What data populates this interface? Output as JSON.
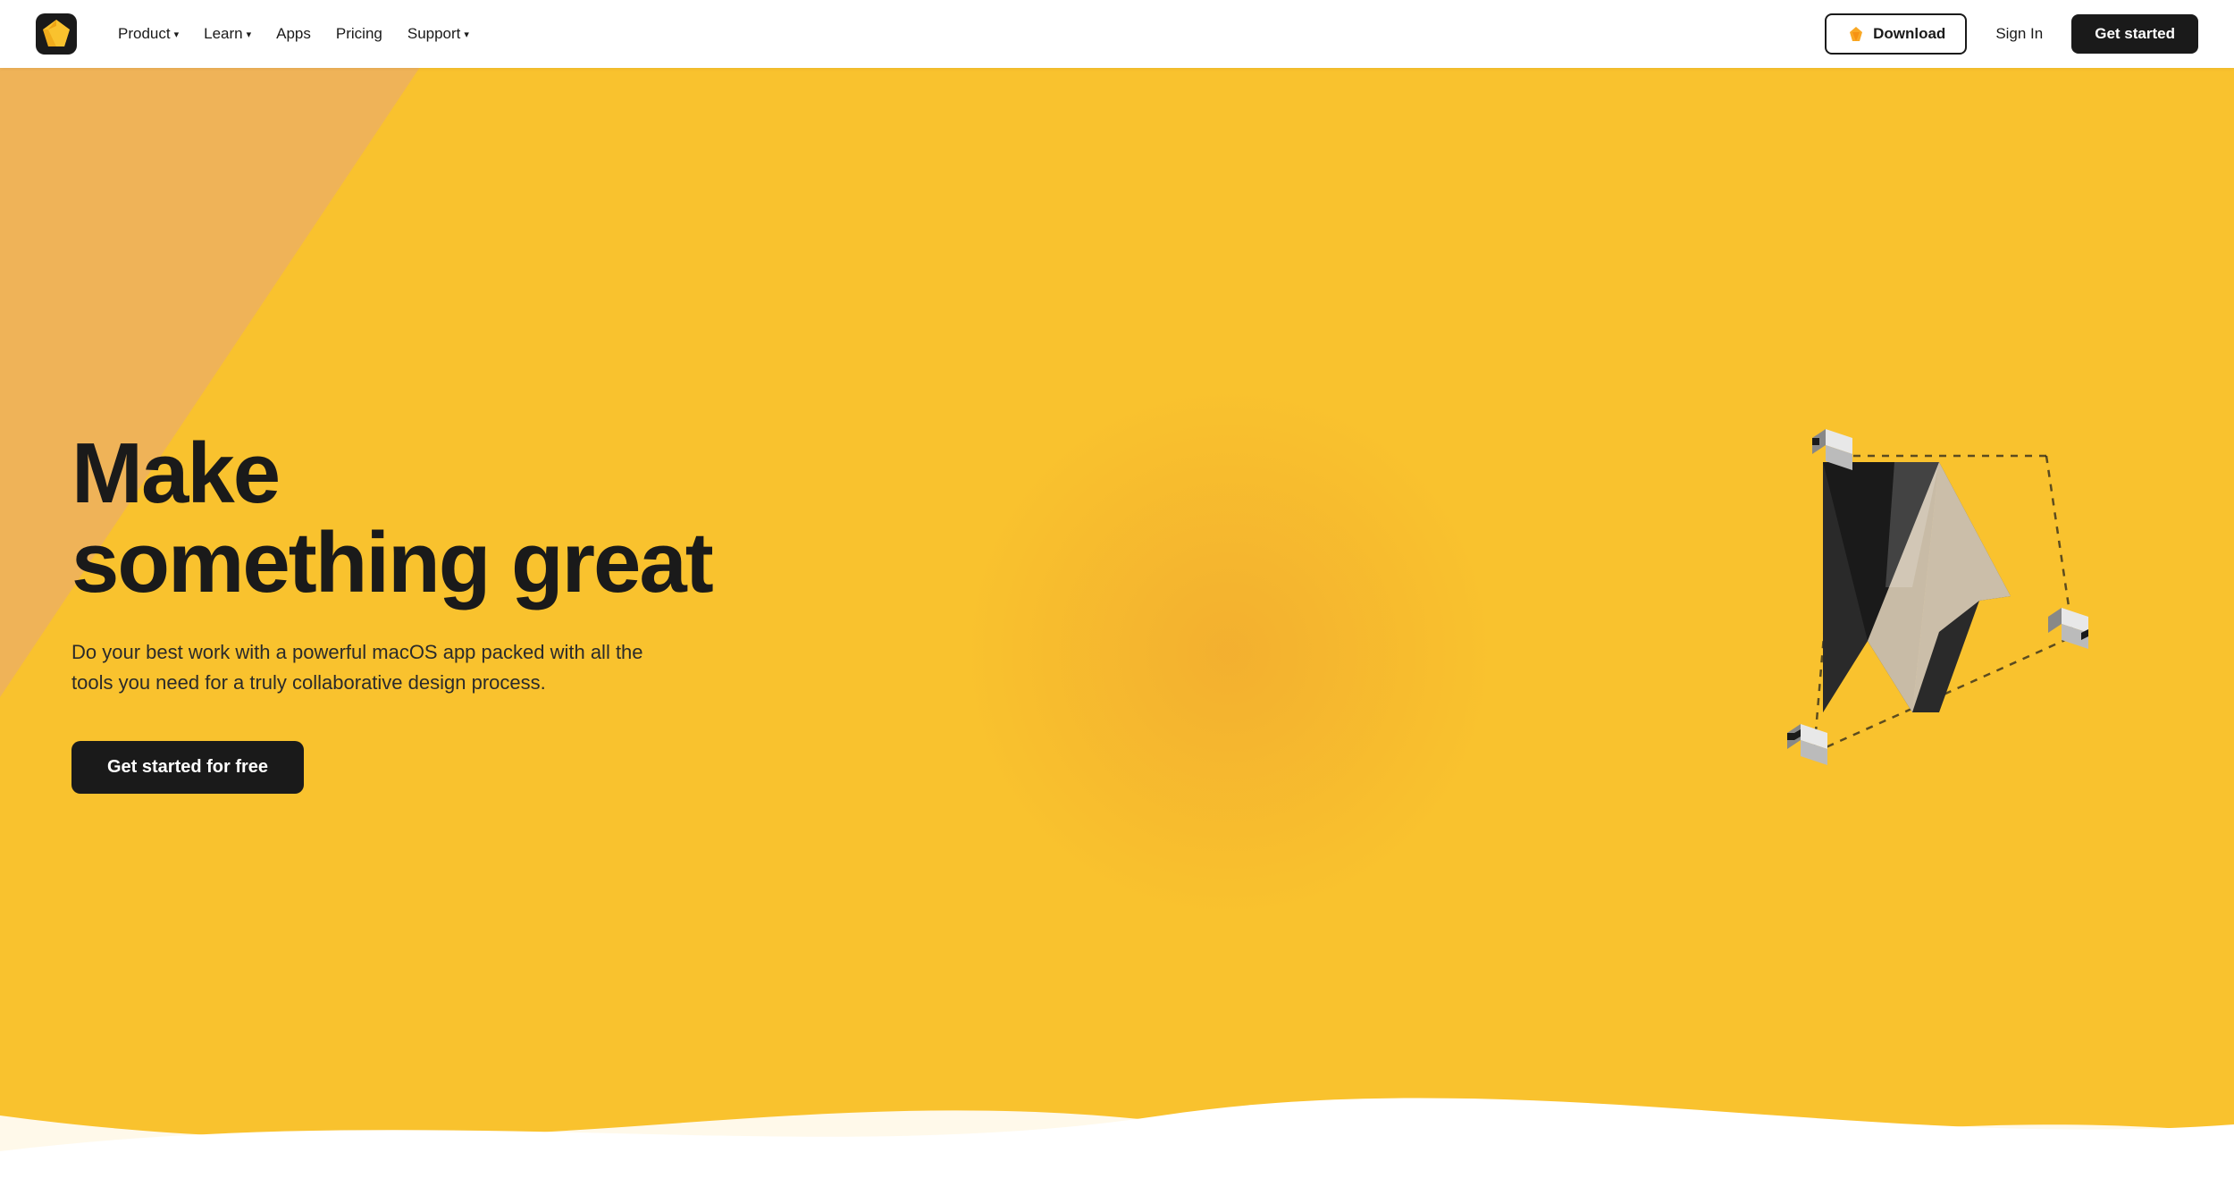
{
  "nav": {
    "logo_alt": "Sketch logo",
    "items": [
      {
        "id": "product",
        "label": "Product",
        "has_chevron": true
      },
      {
        "id": "learn",
        "label": "Learn",
        "has_chevron": true
      },
      {
        "id": "apps",
        "label": "Apps",
        "has_chevron": false
      },
      {
        "id": "pricing",
        "label": "Pricing",
        "has_chevron": false
      },
      {
        "id": "support",
        "label": "Support",
        "has_chevron": true
      }
    ],
    "download_label": "Download",
    "signin_label": "Sign In",
    "getstarted_label": "Get started"
  },
  "hero": {
    "title_line1": "Make",
    "title_line2": "something great",
    "subtitle": "Do your best work with a powerful macOS app packed with all the tools you need for a truly collaborative design process.",
    "cta_label": "Get started for free"
  },
  "colors": {
    "bg_yellow": "#F9C22E",
    "bg_peach": "#E8A87C",
    "dark": "#1a1a1a",
    "white": "#ffffff"
  }
}
